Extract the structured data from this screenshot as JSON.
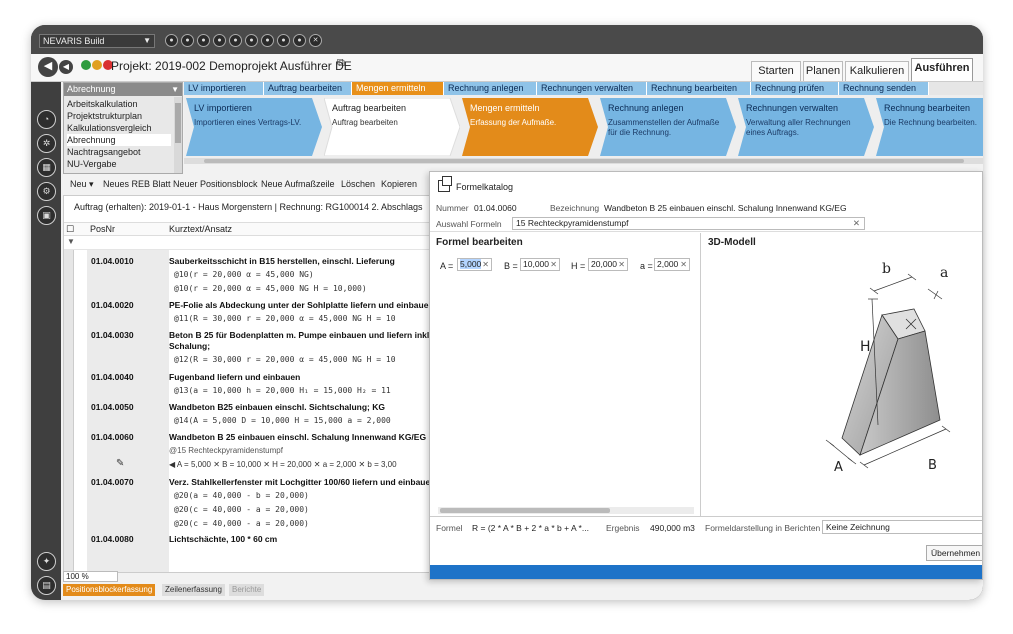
{
  "window": {
    "app_name": "NEVARIS Build",
    "toolbar_icon_count": 10
  },
  "project": {
    "title": "Projekt: 2019-002 Demoprojekt Ausführer DE",
    "tabs": [
      "Starten",
      "Planen",
      "Kalkulieren",
      "Ausführen"
    ],
    "active_tab": "Ausführen"
  },
  "modules": {
    "selected": "Abrechnung",
    "items": [
      "Arbeitskalkulation",
      "Projektstrukturplan",
      "Kalkulationsvergleich",
      "Abrechnung",
      "Nachtragsangebot",
      "NU-Vergabe"
    ]
  },
  "step_strip": [
    "LV importieren",
    "Auftrag bearbeiten",
    "Mengen ermitteln",
    "Rechnung anlegen",
    "Rechnungen verwalten",
    "Rechnung bearbeiten",
    "Rechnung prüfen",
    "Rechnung senden"
  ],
  "workflow_cards": [
    {
      "title": "LV importieren",
      "desc": "Importieren eines Vertrags-LV."
    },
    {
      "title": "Auftrag bearbeiten",
      "desc": "Auftrag bearbeiten"
    },
    {
      "title": "Mengen ermitteln",
      "desc": "Erfassung der Aufmaße."
    },
    {
      "title": "Rechnung anlegen",
      "desc": "Zusammenstellen der Aufmaße für die Rechnung."
    },
    {
      "title": "Rechnungen verwalten",
      "desc": "Verwaltung aller Rechnungen eines Auftrags."
    },
    {
      "title": "Rechnung bearbeiten",
      "desc": "Die Rechnung bearbeiten."
    }
  ],
  "position_toolbar": [
    "Neu ▾",
    "Neues REB Blatt",
    "Neuer Positionsblock",
    "Neue Aufmaßzeile",
    "Löschen",
    "Kopieren"
  ],
  "grid": {
    "header": "Auftrag (erhalten): 2019-01-1 - Haus Morgenstern | Rechnung: RG100014 2. Abschlags",
    "col_posnr": "PosNr",
    "col_text": "Kurztext/Ansatz",
    "rows": [
      {
        "pos": "01.04.0010",
        "text": "Sauberkeitsschicht in B15 herstellen, einschl. Lieferung",
        "lines": [
          "@10(r =  20,000 α =  45,000 NG)",
          "@10(r =  20,000 α =  45,000 NG H =  10,000)"
        ]
      },
      {
        "pos": "01.04.0020",
        "text": "PE-Folie als Abdeckung unter der Sohlplatte liefern und einbauen",
        "lines": [
          "@11(R =  30,000 r =  20,000 α =  45,000 NG H =  10"
        ]
      },
      {
        "pos": "01.04.0030",
        "text": "Beton B 25 für Bodenplatten m. Pumpe einbauen und liefern inkl.",
        "text2": "Schalung;",
        "lines": [
          "@12(R =  30,000 r =  20,000 α =  45,000 NG H =  10"
        ]
      },
      {
        "pos": "01.04.0040",
        "text": "Fugenband liefern und einbauen",
        "lines": [
          "@13(a =  10,000 h =  20,000 H₁ =  15,000 H₂ =  11"
        ]
      },
      {
        "pos": "01.04.0050",
        "text": "Wandbeton B25 einbauen einschl. Sichtschalung; KG",
        "lines": [
          "@14(A =  5,000 D =  10,000 H =  15,000 a =  2,000"
        ]
      },
      {
        "pos": "01.04.0060",
        "text": "Wandbeton B 25 einbauen einschl. Schalung Innenwand KG/EG",
        "plain": "@15 Rechteckpyramidenstumpf",
        "inline": "◀ A = 5,000 ✕ B = 10,000 ✕ H = 20,000 ✕ a = 2,000 ✕ b = 3,00"
      },
      {
        "pos": "01.04.0070",
        "text": "Verz. Stahlkellerfenster mit Lochgitter 100/60 liefern und einbaue",
        "lines": [
          "@20(a =  40,000 - b =  20,000)",
          "@20(c =  40,000 - a =  20,000)",
          "@20(c =  40,000 - a =  20,000)"
        ]
      },
      {
        "pos": "01.04.0080",
        "text": "Lichtschächte, 100 * 60 cm",
        "lines": []
      }
    ]
  },
  "status": {
    "zoom": "100 %",
    "tabs": [
      "Positionsblockerfassung",
      "Zeilenerfassung",
      "Berichte"
    ]
  },
  "dialog": {
    "title": "Formelkatalog",
    "nummer_label": "Nummer",
    "nummer": "01.04.0060",
    "bezeichnung_label": "Bezeichnung",
    "bezeichnung": "Wandbeton B 25 einbauen einschl. Schalung Innenwand KG/EG",
    "auswahl_label": "Auswahl Formeln",
    "auswahl": "15 Rechteckpyramidenstumpf",
    "left_title": "Formel bearbeiten",
    "right_title": "3D-Modell",
    "params": [
      {
        "label": "A =",
        "value": "5,000"
      },
      {
        "label": "B =",
        "value": "10,000"
      },
      {
        "label": "H =",
        "value": "20,000"
      },
      {
        "label": "a =",
        "value": "2,000"
      }
    ],
    "formel_label": "Formel",
    "formel": "R = (2 * A * B + 2 * a * b + A *...",
    "ergebnis_label": "Ergebnis",
    "ergebnis": "490,000 m3",
    "darstellung_label": "Formeldarstellung in Berichten",
    "darstellung": "Keine Zeichnung",
    "apply_label": "Übernehmen",
    "model_labels": [
      "b",
      "a",
      "H",
      "A",
      "B"
    ]
  }
}
